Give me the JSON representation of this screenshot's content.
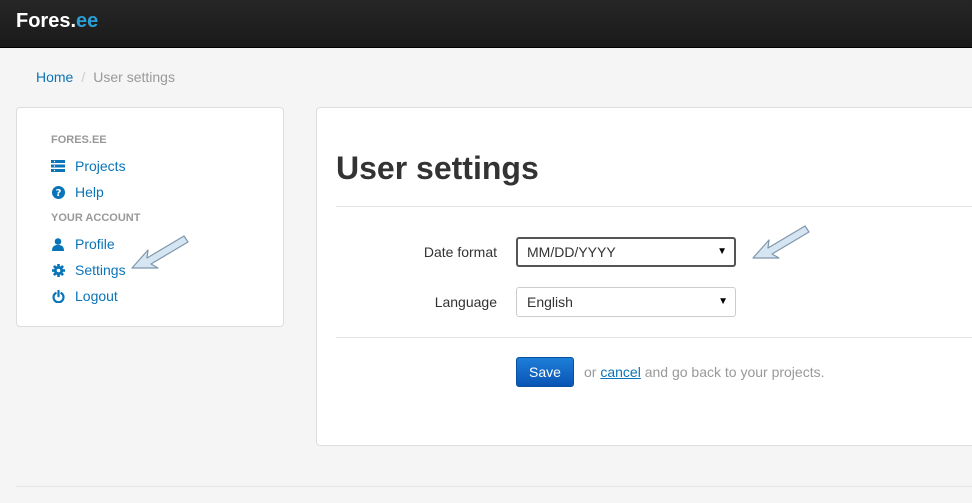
{
  "navbar": {
    "brand_main": "Fores.",
    "brand_accent": "ee"
  },
  "breadcrumb": {
    "home": "Home",
    "separator": "/",
    "current": "User settings"
  },
  "sidebar": {
    "header_1": "FORES.EE",
    "items_1": [
      {
        "label": "Projects",
        "icon": "list-icon"
      },
      {
        "label": "Help",
        "icon": "question-circle-icon"
      }
    ],
    "header_2": "YOUR ACCOUNT",
    "items_2": [
      {
        "label": "Profile",
        "icon": "user-icon"
      },
      {
        "label": "Settings",
        "icon": "gear-icon"
      },
      {
        "label": "Logout",
        "icon": "power-icon"
      }
    ]
  },
  "main": {
    "title": "User settings",
    "date_format": {
      "label": "Date format",
      "value": "MM/DD/YYYY"
    },
    "language": {
      "label": "Language",
      "value": "English"
    },
    "save_label": "Save",
    "note_before": "or",
    "cancel_label": "cancel",
    "note_after": "and go back to your projects."
  },
  "colors": {
    "link": "#0a74b8",
    "brand_accent": "#2a9fd6",
    "navbar_bg": "#1f1f1f",
    "primary_button": "#0a55b5",
    "annotation_arrow": "#d5e5f2"
  }
}
